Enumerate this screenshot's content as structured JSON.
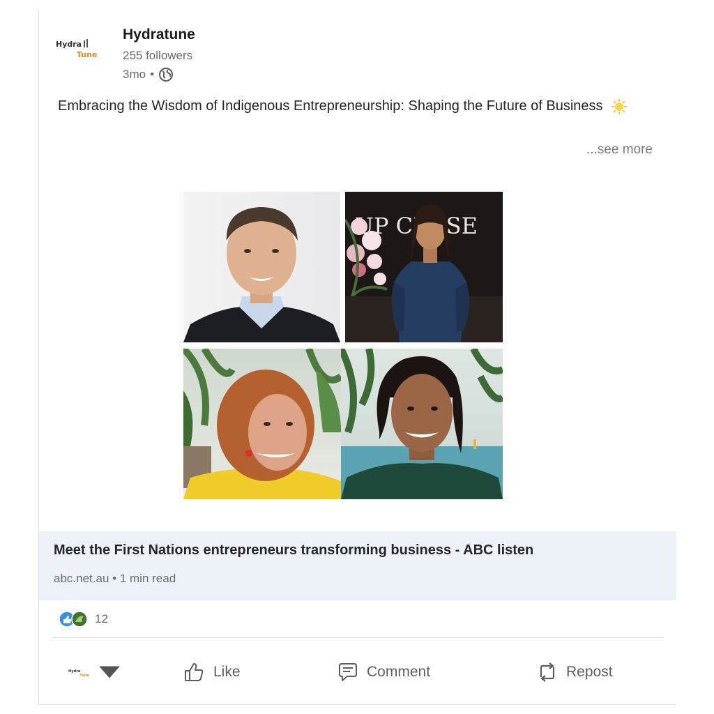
{
  "post": {
    "company_name": "Hydratune",
    "followers": "255 followers",
    "time_ago": "3mo",
    "separator": "•",
    "text": "Embracing the Wisdom of Indigenous Entrepreneurship: Shaping the Future of Business",
    "see_more": "...see more",
    "logo_text_top": "Hydra",
    "logo_text_bottom": "Tune"
  },
  "link_preview": {
    "title": "Meet the First Nations entrepreneurs transforming business - ABC listen",
    "source": "abc.net.au",
    "separator": "•",
    "read_time": "1 min read"
  },
  "reactions": {
    "count": "12",
    "icons": [
      "like-reaction-icon",
      "support-reaction-icon"
    ]
  },
  "actions": {
    "like": "Like",
    "comment": "Comment",
    "repost": "Repost"
  },
  "image_signage": "UP CLOSE",
  "colors": {
    "link_bg": "#edf2f8",
    "like_blue": "#378fe9",
    "support_green": "#44712e",
    "logo_orange": "#e8891c"
  }
}
